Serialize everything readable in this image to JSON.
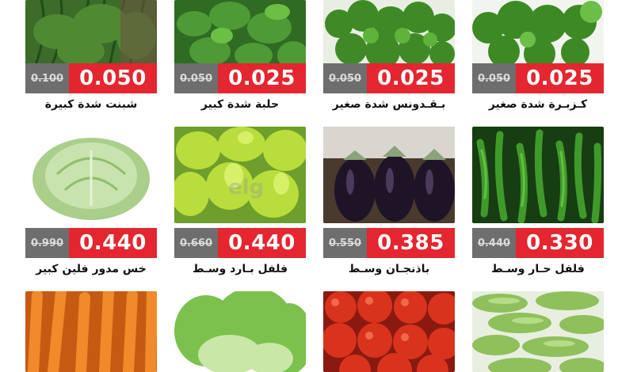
{
  "watermark": "elg",
  "products": [
    {
      "id": "dill",
      "name": "شبنت شدة كبيرة",
      "old_price": "0.100",
      "new_price": "0.050"
    },
    {
      "id": "fenugreek",
      "name": "حلبة شدة كبير",
      "old_price": "0.050",
      "new_price": "0.025"
    },
    {
      "id": "parsley",
      "name": "بـقـدونس شدة صغير",
      "old_price": "0.050",
      "new_price": "0.025"
    },
    {
      "id": "coriander",
      "name": "كـزبـرة شدة صغير",
      "old_price": "0.050",
      "new_price": "0.025"
    },
    {
      "id": "lettuce",
      "name": "خس مدور فلين كبير",
      "old_price": "0.990",
      "new_price": "0.440"
    },
    {
      "id": "sweet-pepper",
      "name": "فلفل بـارد وسـط",
      "old_price": "0.660",
      "new_price": "0.440"
    },
    {
      "id": "eggplant",
      "name": "باذنجـان وسـط",
      "old_price": "0.550",
      "new_price": "0.385"
    },
    {
      "id": "hot-pepper",
      "name": "فلفل حـار وسـط",
      "old_price": "0.440",
      "new_price": "0.330"
    }
  ]
}
